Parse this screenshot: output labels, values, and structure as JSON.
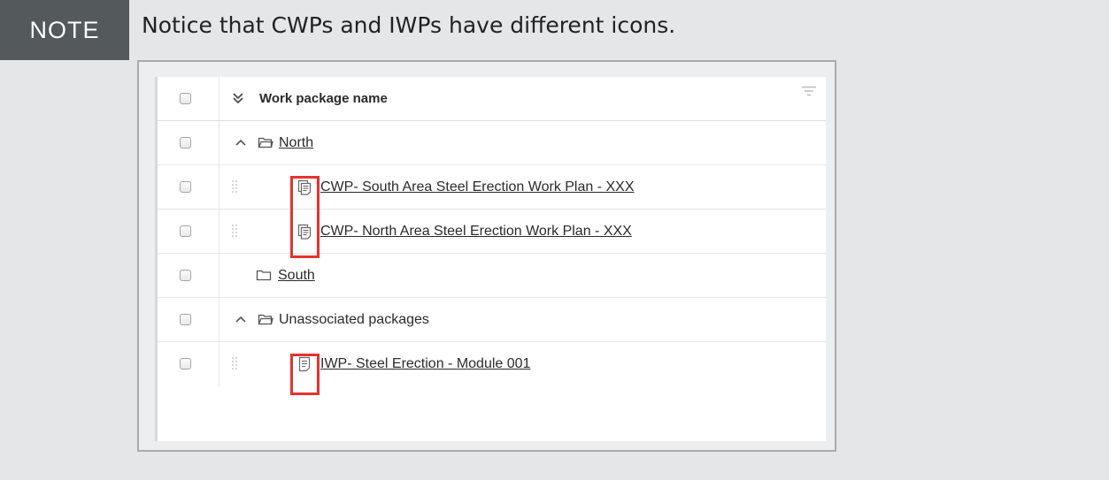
{
  "note": {
    "label": "NOTE",
    "text": "Notice that CWPs and IWPs have different icons."
  },
  "grid": {
    "header": {
      "column_label": "Work package name",
      "collapse_icon": "double-chevron-down-icon",
      "filter_icon": "filter-icon"
    },
    "rows": [
      {
        "label": "North",
        "icon": "folder-open-icon",
        "expand": "chevron-up-icon",
        "underline": true
      },
      {
        "label": "CWP- South Area Steel Erection Work Plan - XXX",
        "icon": "cwp-document-icon",
        "underline": true,
        "highlighted": true
      },
      {
        "label": "CWP- North Area Steel Erection Work Plan - XXX",
        "icon": "cwp-document-icon",
        "underline": true,
        "highlighted": true
      },
      {
        "label": "South",
        "icon": "folder-closed-icon",
        "underline": true
      },
      {
        "label": "Unassociated packages",
        "icon": "folder-open-icon",
        "expand": "chevron-up-icon",
        "underline": false
      },
      {
        "label": "IWP- Steel Erection - Module 001",
        "icon": "iwp-document-icon",
        "underline": true,
        "highlighted": true
      }
    ]
  },
  "colors": {
    "note_label_bg": "#54595b",
    "note_box_bg": "#e4e6e8",
    "highlight_border": "#e8312f"
  }
}
